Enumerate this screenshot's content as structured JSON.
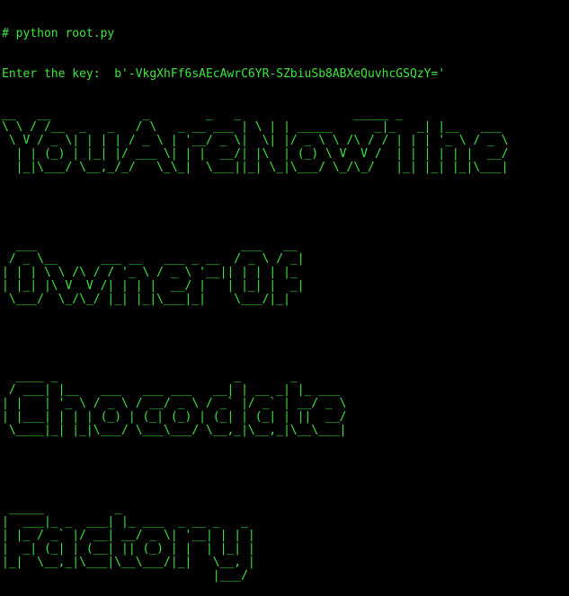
{
  "theme": {
    "background": "#000000",
    "text_color": "#3ee63e"
  },
  "terminal": {
    "command_line": "# python root.py",
    "key_prompt": "Enter the key:  b'-VkgXhFf6sAEcAwrC6YR-SZbiuSb8ABXeQuvhcGSQzY='",
    "banner_line_1": "__   __             _        _   _                _____ _\n\\ \\ / /__  _   _   / \\   _ __ ___ | \\ | | _____      _|_   _| |__   ___\n \\ V / _ \\| | | | / _ \\ | '__/ _ \\|  \\| |/ _ \\ \\ /\\ / / | | | '_ \\ / _ \\\n  | | (_) | |_| |/ ___ \\| | |  __/| |\\  | (_) \\ V  V /  | | | | | |  __/\n  |_|\\___/ \\__,_/_/   \\_\\_|  \\___||_| \\_|\\___/ \\_/\\_/   |_| |_| |_|\\___|",
    "banner_line_2": "  ___                             ___   __\n / _ \\__      ___ __   ___ _ __  / _ \\ / _|\n| | | \\ \\ /\\ / / '_ \\ / _ \\ '__|| | | | |_\n| |_| |\\ V  V /| | | |  __/ |   | |_| |  _|\n \\___/  \\_/\\_/ |_| |_|\\___|_|    \\___/|_|",
    "banner_line_3": "  ____ _                         _       _\n / ___| |__   ___   ___ ___   __| | __ _| |_ ___\n| |   | '_ \\ / _ \\ / __/ _ \\ / _` |/ _` | __/ _ \\\n| |___| | | | (_) | (_| (_) | (_| | (_| | ||  __/\n \\____|_| |_|\\___/ \\___\\___/ \\__,_|\\__,_|\\__\\___|",
    "banner_line_4": " _____          _\n|  ___|_ _  ___| |_ ___  _ __ _   _\n| |_ / _` |/ __| __/ _ \\| '__| | | |\n|  _| (_| | (__| || (_) | |  | |_| |\n|_|  \\__,_|\\___|\\__\\___/|_|   \\__, |\n                              |___/"
  }
}
